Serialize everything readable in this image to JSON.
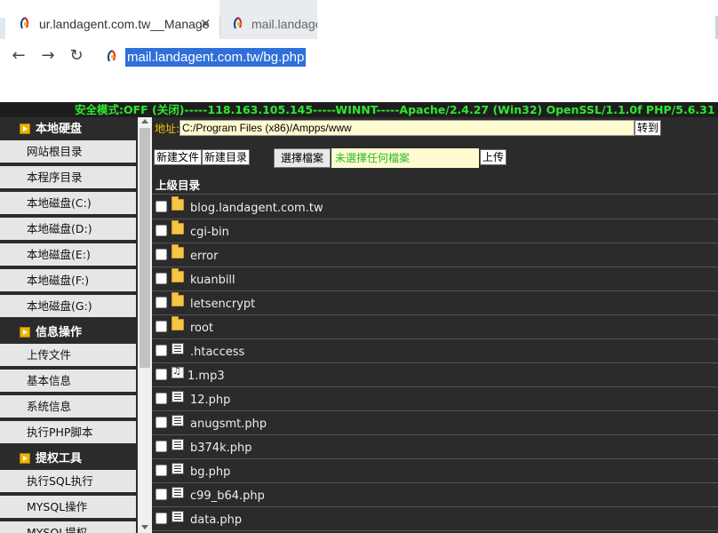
{
  "browser": {
    "tabs": [
      {
        "title": "ur.landagent.com.tw__Manage",
        "close": "×"
      },
      {
        "title": "mail.landage"
      }
    ],
    "nav": {
      "back": "←",
      "forward": "→",
      "reload": "↻"
    },
    "url": "mail.landagent.com.tw/bg.php"
  },
  "page": {
    "status_bar": "安全模式:OFF (关闭)-----118.163.105.145-----WINNT-----Apache/2.4.27 (Win32) OpenSSL/1.1.0f PHP/5.6.31",
    "sidebar": [
      {
        "type": "head",
        "label": "本地硬盘"
      },
      {
        "type": "item",
        "label": "网站根目录"
      },
      {
        "type": "item",
        "label": "本程序目录"
      },
      {
        "type": "item",
        "label": "本地磁盘(C:)"
      },
      {
        "type": "item",
        "label": "本地磁盘(D:)"
      },
      {
        "type": "item",
        "label": "本地磁盘(E:)"
      },
      {
        "type": "item",
        "label": "本地磁盘(F:)"
      },
      {
        "type": "item",
        "label": "本地磁盘(G:)"
      },
      {
        "type": "head",
        "label": "信息操作"
      },
      {
        "type": "item",
        "label": "上传文件"
      },
      {
        "type": "item",
        "label": "基本信息"
      },
      {
        "type": "item",
        "label": "系统信息"
      },
      {
        "type": "item",
        "label": "执行PHP脚本"
      },
      {
        "type": "head",
        "label": "提权工具"
      },
      {
        "type": "item",
        "label": "执行SQL执行"
      },
      {
        "type": "item",
        "label": "MYSQL操作"
      },
      {
        "type": "item",
        "label": "MYSQL提权"
      }
    ],
    "address": {
      "label": "地址:",
      "value": "C:/Program Files (x86)/Ampps/www",
      "go": "转到"
    },
    "actions": {
      "new_file": "新建文件",
      "new_dir": "新建目录",
      "choose_file": "選擇檔案",
      "no_file": "未選擇任何檔案",
      "upload": "上传"
    },
    "parent_dir": "上级目录",
    "files": [
      {
        "name": "blog.landagent.com.tw",
        "icon": "folder-icon"
      },
      {
        "name": "cgi-bin",
        "icon": "folder-icon"
      },
      {
        "name": "error",
        "icon": "folder-icon"
      },
      {
        "name": "kuanbill",
        "icon": "folder-icon"
      },
      {
        "name": "letsencrypt",
        "icon": "folder-icon"
      },
      {
        "name": "root",
        "icon": "folder-icon"
      },
      {
        "name": ".htaccess",
        "icon": "document-icon"
      },
      {
        "name": "1.mp3",
        "icon": "audio-file-icon"
      },
      {
        "name": "12.php",
        "icon": "document-icon"
      },
      {
        "name": "anugsmt.php",
        "icon": "document-icon"
      },
      {
        "name": "b374k.php",
        "icon": "document-icon"
      },
      {
        "name": "bg.php",
        "icon": "document-icon"
      },
      {
        "name": "c99_b64.php",
        "icon": "document-icon"
      },
      {
        "name": "data.php",
        "icon": "document-icon"
      }
    ]
  }
}
